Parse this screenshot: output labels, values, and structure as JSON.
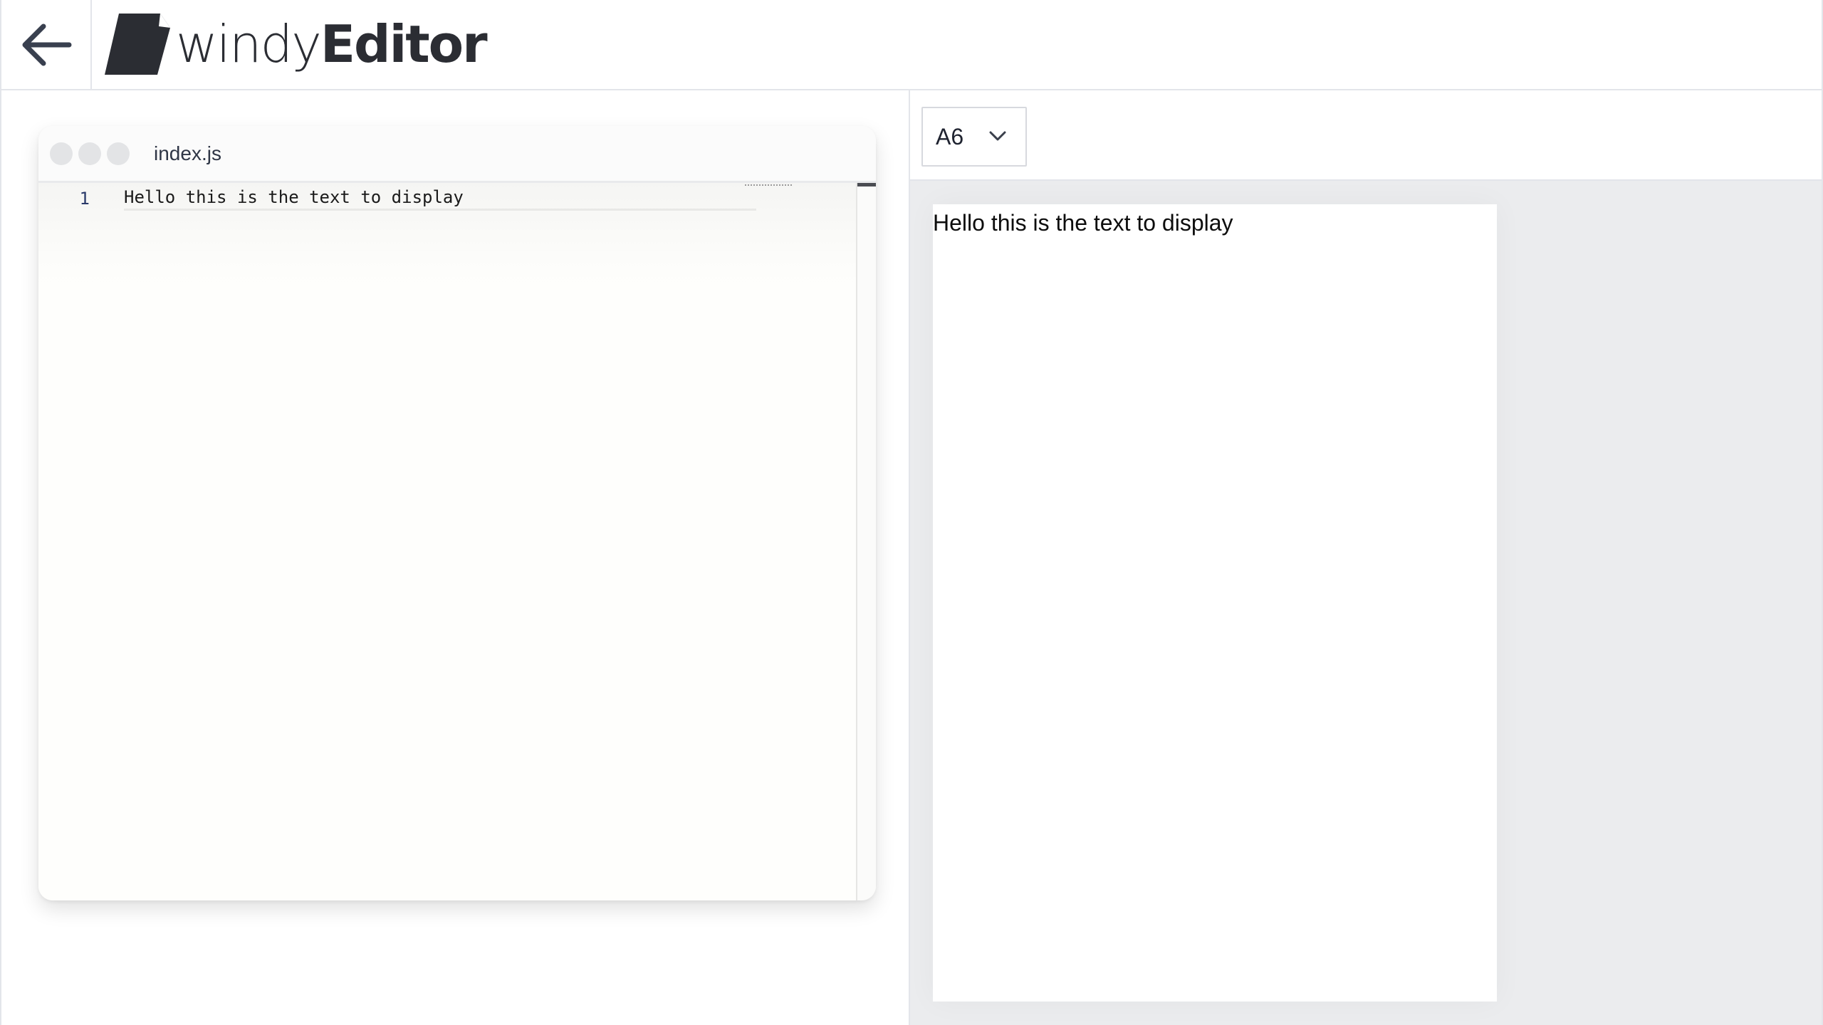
{
  "header": {
    "back_icon": "arrow-left-icon",
    "logo": {
      "mark_icon": "document-icon",
      "word_light": "windy",
      "word_bold": "Editor",
      "color": "#2b2d33"
    }
  },
  "editor": {
    "tab_name": "index.js",
    "lines": [
      {
        "number": "1",
        "text": "Hello this is the text to display"
      }
    ]
  },
  "preview": {
    "paper_size": {
      "selected": "A6",
      "icon": "chevron-down-icon"
    },
    "page_text": "Hello this is the text to display"
  },
  "colors": {
    "preview_background": "#ebecee",
    "border": "#e3e5ea",
    "editor_background": "#fefefc"
  }
}
